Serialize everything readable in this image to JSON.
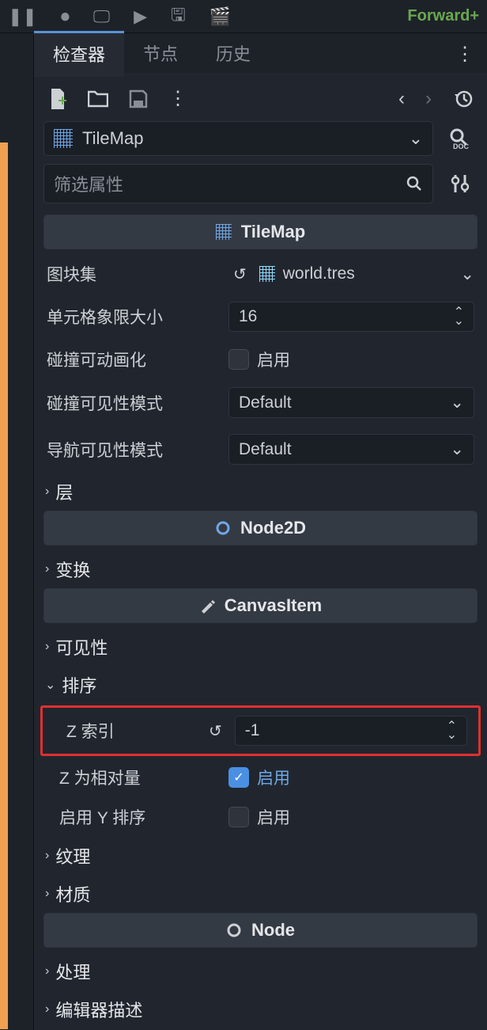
{
  "topbar": {
    "forward_label": "Forward+"
  },
  "tabs": {
    "inspector": "检查器",
    "node": "节点",
    "history": "历史"
  },
  "object": {
    "name": "TileMap"
  },
  "filter": {
    "placeholder": "筛选属性"
  },
  "section_tilemap": "TileMap",
  "props": {
    "tileset_label": "图块集",
    "tileset_value": "world.tres",
    "cell_quadrant_label": "单元格象限大小",
    "cell_quadrant_value": "16",
    "collision_anim_label": "碰撞可动画化",
    "collision_visibility_label": "碰撞可见性模式",
    "collision_visibility_value": "Default",
    "nav_visibility_label": "导航可见性模式",
    "nav_visibility_value": "Default",
    "enable_text": "启用"
  },
  "group_layers": "层",
  "section_node2d": "Node2D",
  "group_transform": "变换",
  "section_canvasitem": "CanvasItem",
  "group_visibility": "可见性",
  "group_ordering": "排序",
  "ordering": {
    "z_index_label": "Z 索引",
    "z_index_value": "-1",
    "z_relative_label": "Z 为相对量",
    "y_sort_label": "启用 Y 排序"
  },
  "group_texture": "纹理",
  "group_material": "材质",
  "section_node": "Node",
  "group_process": "处理",
  "group_editor_desc": "编辑器描述"
}
